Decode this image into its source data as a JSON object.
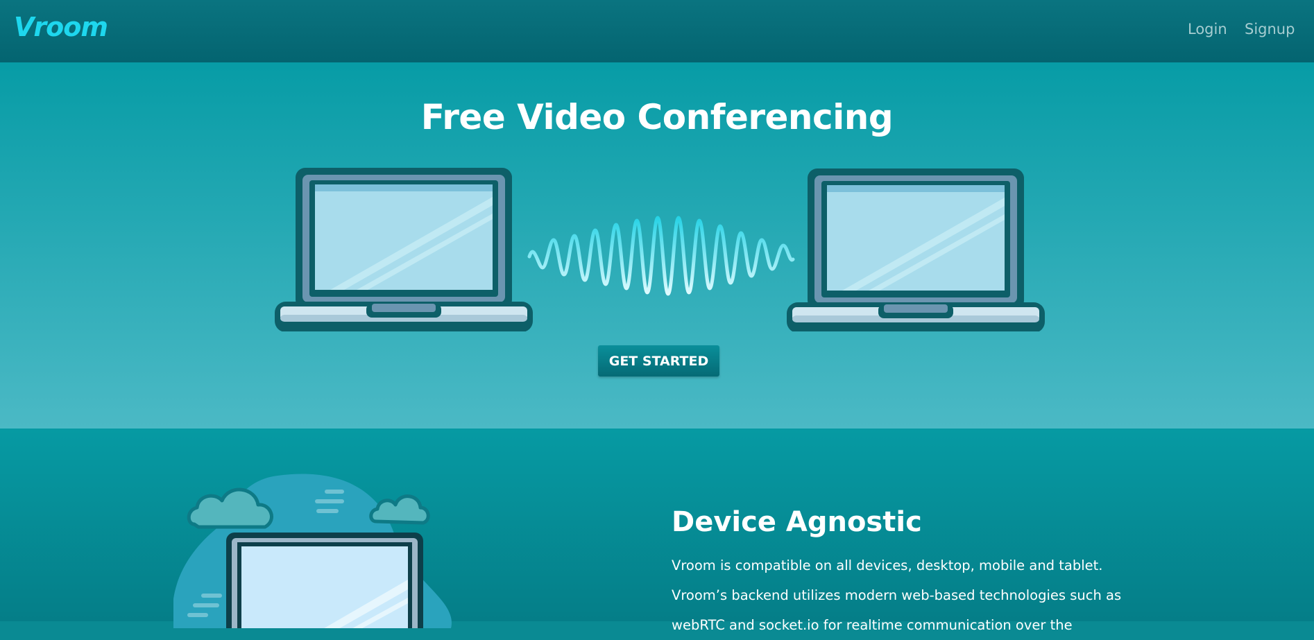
{
  "nav": {
    "logo": "Vroom",
    "links": [
      {
        "label": "Login"
      },
      {
        "label": "Signup"
      }
    ]
  },
  "hero": {
    "title": "Free Video Conferencing",
    "cta_label": "GET STARTED"
  },
  "feature": {
    "title": "Device Agnostic",
    "paragraph": "Vroom is compatible on all devices, desktop, mobile and tablet. Vroom’s backend utilizes modern web-based technologies such as webRTC and socket.io for realtime communication over the"
  },
  "icons": {
    "left_laptop": "laptop-icon",
    "right_laptop": "laptop-icon",
    "wave": "sound-wave-icon",
    "feature_illustration": "laptop-clouds-illustration"
  },
  "colors": {
    "brand": "#1ed7ee",
    "nav_bg": "#046470",
    "hero_top": "#079ca6",
    "hero_bottom": "#4bb9c5",
    "button": "#087c87"
  }
}
